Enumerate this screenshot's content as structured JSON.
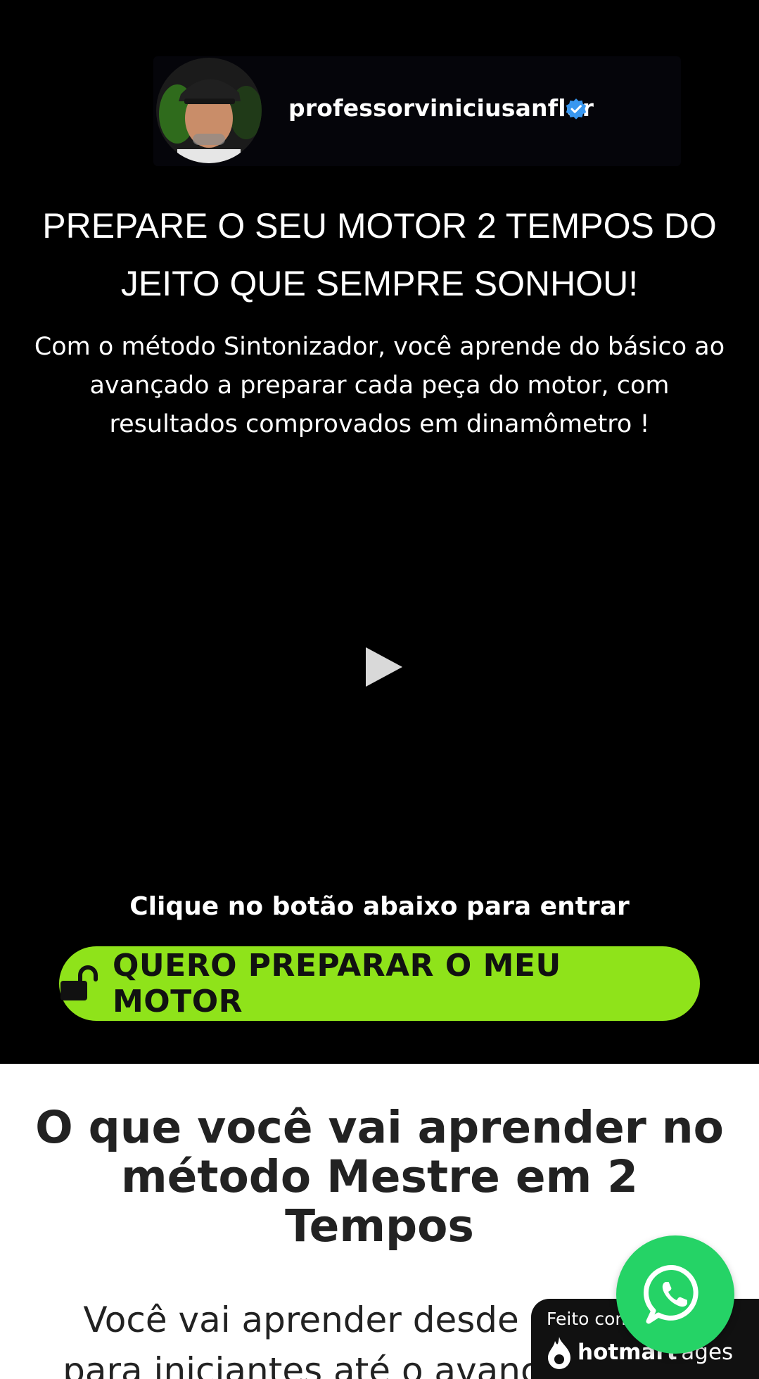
{
  "profile": {
    "username": "professorviniciusanflor",
    "verified": true
  },
  "hero": {
    "headline_line1": "PREPARE O SEU MOTOR 2 TEMPOS DO",
    "headline_line2": "JEITO QUE SEMPRE SONHOU!",
    "subheadline_line1": "Com o método Sintonizador, você aprende do básico ao",
    "subheadline_line2": "avançado a preparar cada peça do motor, com",
    "subheadline_line3": "resultados comprovados em dinamômetro !"
  },
  "video": {
    "icon": "play-icon"
  },
  "cta": {
    "caption": "Clique no botão abaixo para entrar",
    "button_label": "QUERO PREPARAR O MEU MOTOR",
    "icon": "unlock-icon"
  },
  "section": {
    "title_line1": "O que você vai aprender no",
    "title_line2": "método Mestre em 2 Tempos",
    "body_line1": "Você vai aprender desde o básico",
    "body_line2": "para iniciantes até o avançado para"
  },
  "badge": {
    "made_with": "Feito com",
    "brand": "hotmart",
    "pages": "Pages"
  },
  "colors": {
    "cta_green": "#8fe31a",
    "whatsapp_green": "#25d366",
    "verified_blue": "#3897f0",
    "hero_bg": "#000000"
  }
}
